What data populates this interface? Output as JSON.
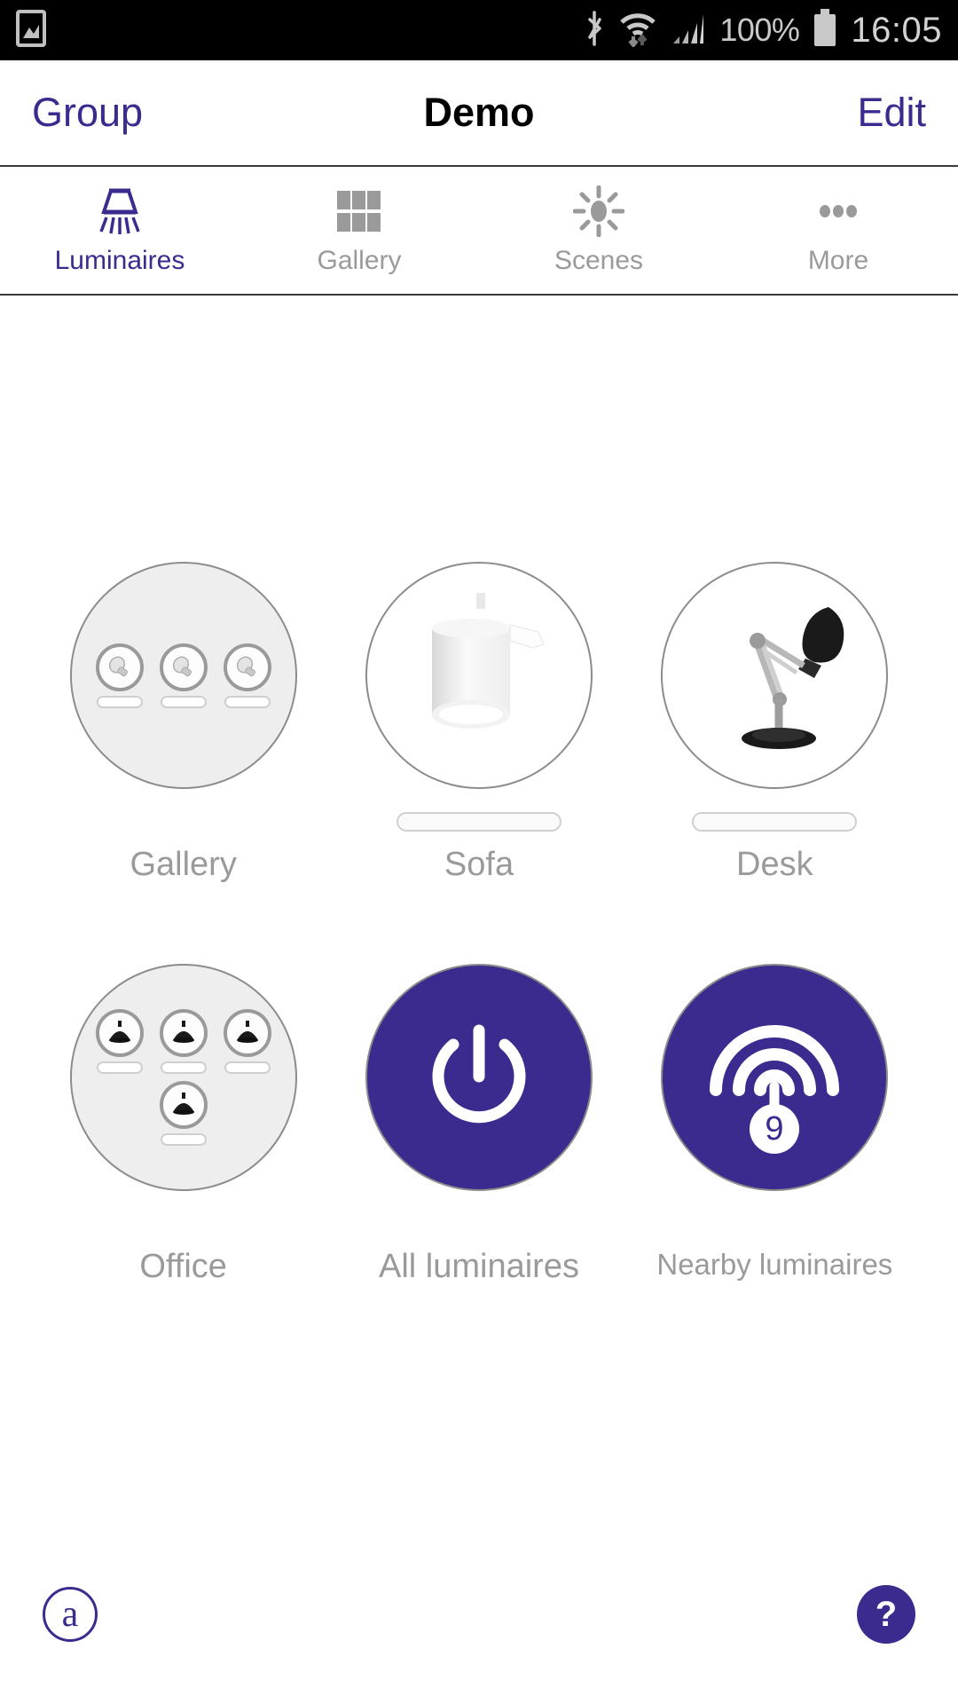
{
  "status_bar": {
    "left_icons": [
      "image-icon"
    ],
    "right_icons": [
      "bluetooth-icon",
      "wifi-icon",
      "signal-icon",
      "battery-icon"
    ],
    "battery_percent": "100%",
    "time": "16:05"
  },
  "nav": {
    "left_label": "Group",
    "title": "Demo",
    "right_label": "Edit"
  },
  "tabs": [
    {
      "label": "Luminaires",
      "icon": "luminaire-icon",
      "active": true
    },
    {
      "label": "Gallery",
      "icon": "grid-icon",
      "active": false
    },
    {
      "label": "Scenes",
      "icon": "sun-icon",
      "active": false
    },
    {
      "label": "More",
      "icon": "ellipsis-icon",
      "active": false
    }
  ],
  "luminaires": [
    {
      "label": "Gallery",
      "icon": "bulb-group-icon",
      "has_slider": false,
      "style": "group"
    },
    {
      "label": "Sofa",
      "icon": "wall-lamp-photo",
      "has_slider": true,
      "style": "photo"
    },
    {
      "label": "Desk",
      "icon": "desk-lamp-photo",
      "has_slider": true,
      "style": "photo"
    },
    {
      "label": "Office",
      "icon": "pendant-group-icon",
      "has_slider": false,
      "style": "group"
    },
    {
      "label": "All luminaires",
      "icon": "power-icon",
      "has_slider": false,
      "style": "purple"
    },
    {
      "label": "Nearby luminaires",
      "icon": "broadcast-icon",
      "has_slider": false,
      "style": "purple",
      "badge": "9"
    }
  ],
  "bottom": {
    "logo_label": "a",
    "help_label": "?"
  },
  "colors": {
    "accent": "#3c2b8f",
    "label_gray": "#9a9a9a",
    "tile_gray": "#eeeeee"
  }
}
